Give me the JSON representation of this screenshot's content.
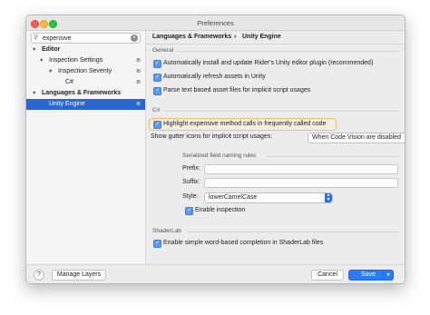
{
  "window": {
    "title": "Preferences"
  },
  "sidebar": {
    "search": {
      "value": "expensive",
      "icon": "search-icon"
    },
    "items": [
      {
        "label": "Editor"
      },
      {
        "label": "Inspection Settings"
      },
      {
        "label": "Inspection Severity"
      },
      {
        "label": "C#"
      },
      {
        "label": "Languages & Frameworks"
      },
      {
        "label": "Unity Engine"
      }
    ]
  },
  "breadcrumb": {
    "parent": "Languages & Frameworks",
    "separator": "›",
    "current": "Unity Engine"
  },
  "general": {
    "heading": "General",
    "options": [
      {
        "label": "Automatically install and update Rider's Unity editor plugin (recommended)",
        "checked": true
      },
      {
        "label": "Automatically refresh assets in Unity",
        "checked": true
      },
      {
        "label": "Parse text based asset files for implicit script usages",
        "checked": true
      }
    ]
  },
  "csharp": {
    "heading": "C#",
    "highlight_option": {
      "label": "Highlight expensive method calls in frequently called code",
      "checked": true
    },
    "gutter_label": "Show gutter icons for implicit script usages:",
    "gutter_value": "When Code Vision are disabled",
    "serialized_heading": "Serialized field naming rules",
    "prefix_label": "Prefix:",
    "prefix_value": "",
    "suffix_label": "Suffix:",
    "suffix_value": "",
    "style_label": "Style:",
    "style_value": "lowerCamelCase",
    "enable_inspection": {
      "label": "Enable inspection",
      "checked": true
    }
  },
  "shaderlab": {
    "heading": "ShaderLab",
    "option": {
      "label": "Enable simple word-based completion in ShaderLab files",
      "checked": true
    }
  },
  "footer": {
    "help": "?",
    "manage_layers": "Manage Layers",
    "cancel": "Cancel",
    "save": "Save"
  },
  "colors": {
    "accent": "#2e7bf6",
    "selection": "#2a66d2",
    "highlight_border": "#f0c36a"
  }
}
